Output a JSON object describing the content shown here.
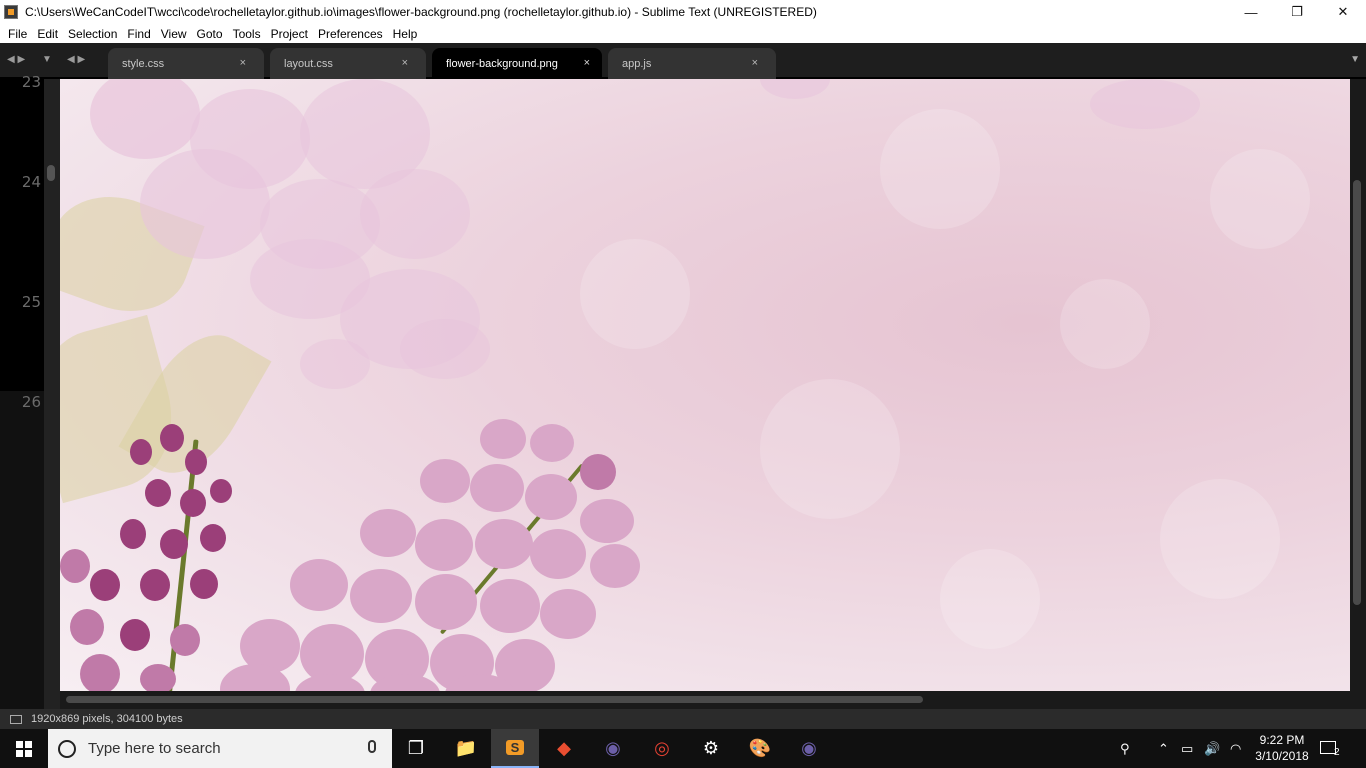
{
  "window": {
    "title": "C:\\Users\\WeCanCodeIT\\wcci\\code\\rochelletaylor.github.io\\images\\flower-background.png (rochelletaylor.github.io) - Sublime Text (UNREGISTERED)",
    "minimize": "—",
    "maximize": "❐",
    "close": "✕"
  },
  "menu": [
    "File",
    "Edit",
    "Selection",
    "Find",
    "View",
    "Goto",
    "Tools",
    "Project",
    "Preferences",
    "Help"
  ],
  "tabs": [
    {
      "label": "style.css",
      "active": false
    },
    {
      "label": "layout.css",
      "active": false
    },
    {
      "label": "flower-background.png",
      "active": true
    },
    {
      "label": "app.js",
      "active": false
    }
  ],
  "tab_close_glyph": "×",
  "line_numbers": [
    "23",
    "24",
    "25",
    "26"
  ],
  "image": {
    "alt": "flower-background.png",
    "icon": "lilac-flowers-image"
  },
  "status": {
    "text": "1920x869 pixels, 304100 bytes"
  },
  "taskbar": {
    "search_placeholder": "Type here to search",
    "apps": [
      {
        "name": "task-view-icon",
        "glyph": "❐"
      },
      {
        "name": "file-explorer-icon",
        "glyph": "📁"
      },
      {
        "name": "sublime-text-icon",
        "glyph": "S"
      },
      {
        "name": "git-icon",
        "glyph": "◆"
      },
      {
        "name": "eclipse-icon",
        "glyph": "◉"
      },
      {
        "name": "chrome-icon",
        "glyph": "◎"
      },
      {
        "name": "settings-icon",
        "glyph": "⚙"
      },
      {
        "name": "paint-icon",
        "glyph": "🎨"
      },
      {
        "name": "eclipse-icon-2",
        "glyph": "◉"
      }
    ],
    "tray": {
      "people": "⚲",
      "chevron": "⌃",
      "battery": "▭",
      "volume": "🔊",
      "wifi": "◠"
    },
    "time": "9:22 PM",
    "date": "3/10/2018",
    "notification_count": "2"
  }
}
